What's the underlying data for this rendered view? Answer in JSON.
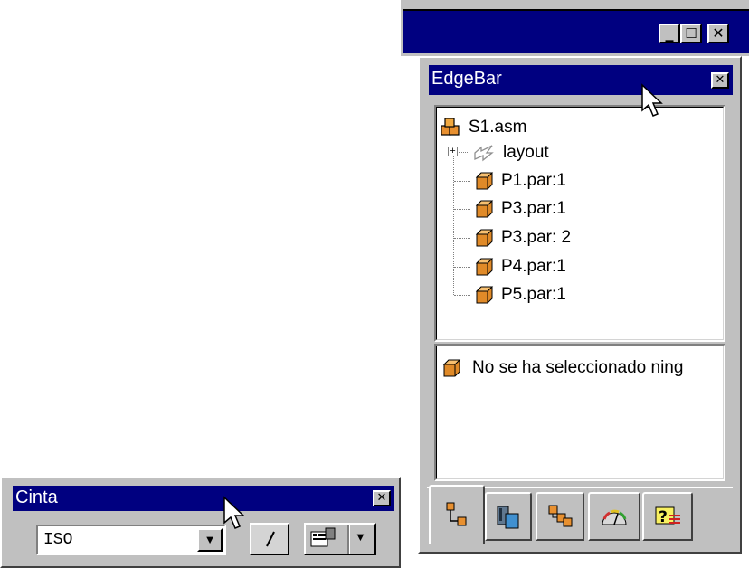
{
  "app_window": {
    "caption_buttons": [
      {
        "name": "minimize",
        "glyph": "_"
      },
      {
        "name": "maximize",
        "glyph": "☐"
      },
      {
        "name": "close",
        "glyph": "✕"
      }
    ]
  },
  "edgebar": {
    "title": "EdgeBar",
    "close_glyph": "✕",
    "tree": {
      "root": "S1.asm",
      "expand_glyph": "+",
      "items": [
        {
          "label": "layout",
          "icon": "layout-icon"
        },
        {
          "label": "P1.par:1",
          "icon": "part-cube-icon"
        },
        {
          "label": "P3.par:1",
          "icon": "part-cube-icon"
        },
        {
          "label": "P3.par: 2",
          "icon": "part-cube-icon"
        },
        {
          "label": "P4.par:1",
          "icon": "part-cube-icon"
        },
        {
          "label": "P5.par:1",
          "icon": "part-cube-icon"
        }
      ]
    },
    "selection_text": "No se ha seleccionado ning",
    "tabs": [
      "assembly-pathfinder-icon",
      "library-icon",
      "parts-icon",
      "sensor-icon",
      "help-icon"
    ]
  },
  "cinta": {
    "title": "Cinta",
    "close_glyph": "✕",
    "select_value": "ISO",
    "dropdown_glyph": "▼",
    "menu_arrow_glyph": "▼"
  },
  "colors": {
    "titlebar": "#000080",
    "face": "#c0c0c0",
    "part_orange": "#d88020"
  }
}
